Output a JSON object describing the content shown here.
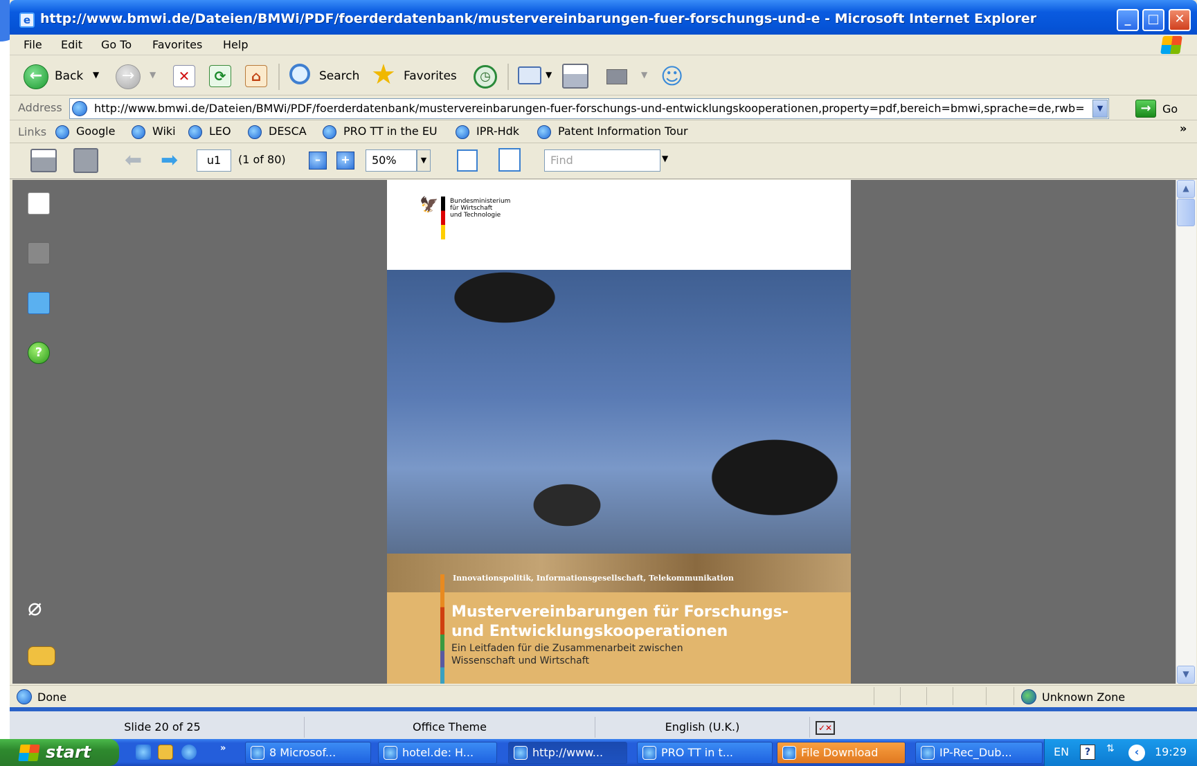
{
  "window": {
    "title": "http://www.bmwi.de/Dateien/BMWi/PDF/foerderdatenbank/mustervereinbarungen-fuer-forschungs-und-e - Microsoft Internet Explorer"
  },
  "menu": [
    "File",
    "Edit",
    "Go To",
    "Favorites",
    "Help"
  ],
  "toolbar": {
    "back_label": "Back",
    "search_label": "Search",
    "favorites_label": "Favorites"
  },
  "address": {
    "label": "Address",
    "url": "http://www.bmwi.de/Dateien/BMWi/PDF/foerderdatenbank/mustervereinbarungen-fuer-forschungs-und-entwicklungskooperationen,property=pdf,bereich=bmwi,sprache=de,rwb=",
    "go_label": "Go"
  },
  "links": {
    "label": "Links",
    "items": [
      "Google",
      "Wiki",
      "LEO",
      "DESCA",
      "PRO TT in the EU",
      "IPR-Hdk",
      "Patent Information Tour"
    ],
    "overflow": "»"
  },
  "pdf_toolbar": {
    "page_input": "u1",
    "page_count": "(1 of 80)",
    "zoom": "50%",
    "find_placeholder": "Find"
  },
  "pdf": {
    "ministry": [
      "Bundesministerium",
      "für Wirtschaft",
      "und Technologie"
    ],
    "band_text": "Innovationspolitik, Informationsgesellschaft, Telekommunikation",
    "title_line1": "Mustervereinbarungen für Forschungs-",
    "title_line2": "und Entwicklungskooperationen",
    "subtitle_line1": "Ein Leitfaden für die Zusammenarbeit zwischen",
    "subtitle_line2": "Wissenschaft und Wirtschaft"
  },
  "status": {
    "text": "Done",
    "zone": "Unknown Zone"
  },
  "ppt_status": {
    "slide": "Slide 20 of 25",
    "theme": "Office Theme",
    "language": "English (U.K.)"
  },
  "taskbar": {
    "start": "start",
    "tasks": [
      "8 Microsof...",
      "hotel.de: H...",
      "http://www...",
      "PRO TT in t...",
      "File Download",
      "IP-Rec_Dub..."
    ],
    "lang": "EN",
    "clock": "19:29"
  }
}
